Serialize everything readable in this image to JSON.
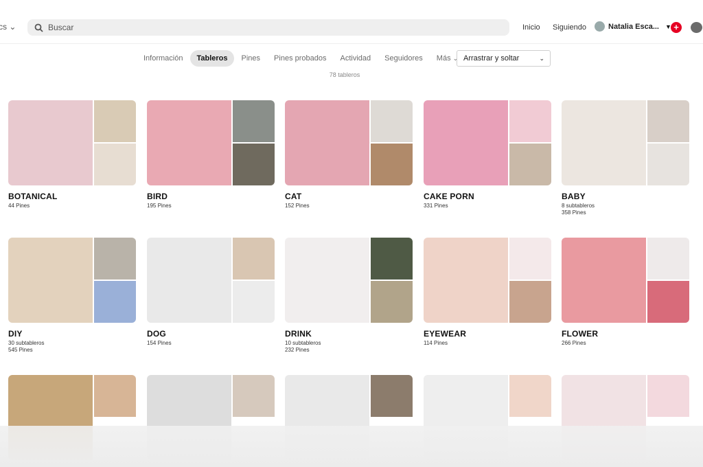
{
  "header": {
    "left_cut_label": "cs",
    "search_placeholder": "Buscar",
    "nav": {
      "home": "Inicio",
      "following": "Siguiendo"
    },
    "user_name": "Natalia Esca...",
    "create_label": "+"
  },
  "tabs": [
    "Información",
    "Tableros",
    "Pines",
    "Pines probados",
    "Actividad",
    "Seguidores",
    "Más"
  ],
  "active_tab": "Tableros",
  "sort_select": {
    "value": "Arrastrar y soltar"
  },
  "board_count": "78 tableros",
  "boards": [
    {
      "name": "BOTANICAL",
      "sub": "",
      "pins": "44 Pines",
      "colors": [
        "#e8c9cf",
        "#d9cbb5",
        "#e7ddd2"
      ]
    },
    {
      "name": "BIRD",
      "sub": "",
      "pins": "195 Pines",
      "colors": [
        "#e9a9b3",
        "#8a8f8a",
        "#6f6a5e"
      ]
    },
    {
      "name": "CAT",
      "sub": "",
      "pins": "152 Pines",
      "colors": [
        "#e4a6b2",
        "#dedad5",
        "#b08a6a"
      ]
    },
    {
      "name": "CAKE PORN",
      "sub": "",
      "pins": "331 Pines",
      "colors": [
        "#e8a0b8",
        "#f1cbd4",
        "#c9b9a8"
      ]
    },
    {
      "name": "BABY",
      "sub": "8 subtableros",
      "pins": "358 Pines",
      "colors": [
        "#ece6e0",
        "#d8cfc8",
        "#e7e3df"
      ]
    },
    {
      "name": "DIY",
      "sub": "30 subtableros",
      "pins": "545 Pines",
      "colors": [
        "#e3d2bd",
        "#b9b3a9",
        "#9ab0d8"
      ]
    },
    {
      "name": "DOG",
      "sub": "",
      "pins": "154 Pines",
      "colors": [
        "#e9e9e9",
        "#d9c6b2",
        "#ececec"
      ]
    },
    {
      "name": "DRINK",
      "sub": "10 subtableros",
      "pins": "232 Pines",
      "colors": [
        "#f1eeee",
        "#4f5a45",
        "#b1a48a"
      ]
    },
    {
      "name": "EYEWEAR",
      "sub": "",
      "pins": "114 Pines",
      "colors": [
        "#efd3c8",
        "#f4e9ea",
        "#c8a48e"
      ]
    },
    {
      "name": "FLOWER",
      "sub": "",
      "pins": "266 Pines",
      "colors": [
        "#e99aa0",
        "#eeeaea",
        "#d86b7a"
      ]
    },
    {
      "name": "",
      "sub": "",
      "pins": "",
      "colors": [
        "#c7a77a",
        "#d7b596",
        "#ffffff"
      ]
    },
    {
      "name": "",
      "sub": "",
      "pins": "",
      "colors": [
        "#dddddd",
        "#d6c9bd",
        "#ffffff"
      ]
    },
    {
      "name": "",
      "sub": "",
      "pins": "",
      "colors": [
        "#e9e9e9",
        "#8c7c6c",
        "#ffffff"
      ]
    },
    {
      "name": "",
      "sub": "",
      "pins": "",
      "colors": [
        "#eeeeee",
        "#f0d6c9",
        "#ffffff"
      ]
    },
    {
      "name": "",
      "sub": "",
      "pins": "",
      "colors": [
        "#f1e2e4",
        "#f3d9de",
        "#ffffff"
      ]
    }
  ]
}
